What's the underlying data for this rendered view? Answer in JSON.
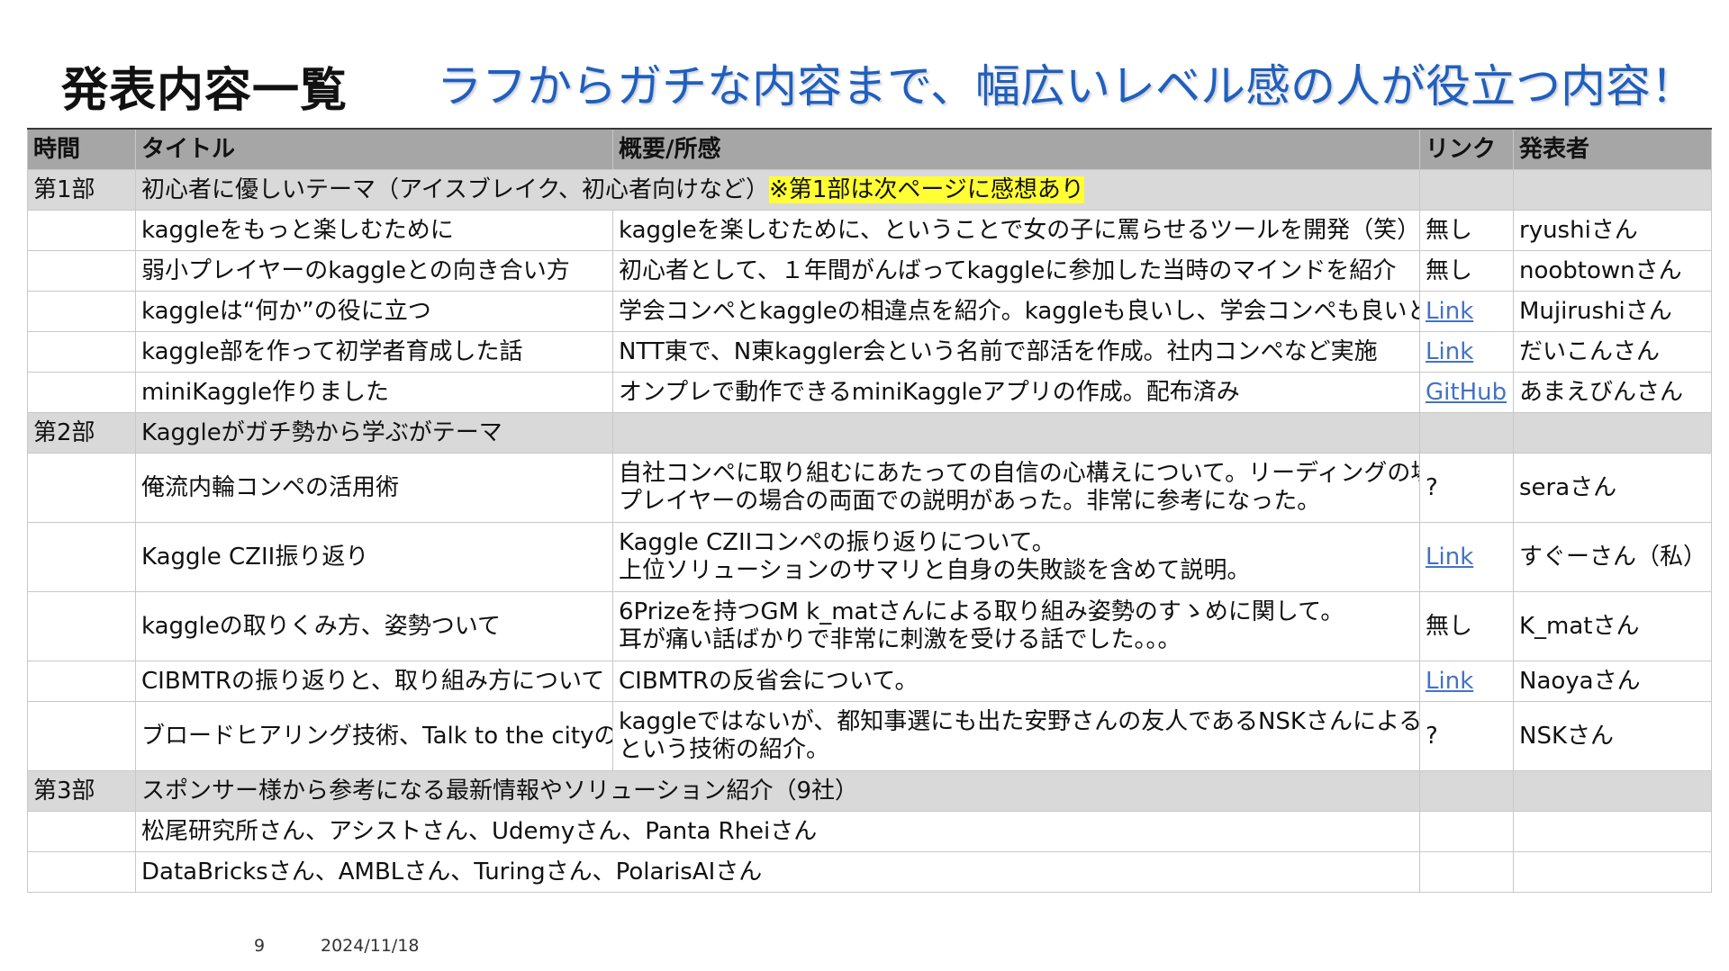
{
  "slide": {
    "title": "発表内容一覧",
    "subtitle": "ラフからガチな内容まで、幅広いレベル感の人が役立つ内容！",
    "page_number": "9",
    "date": "2024/11/18"
  },
  "table": {
    "headers": [
      "時間",
      "タイトル",
      "概要/所感",
      "リンク",
      "発表者"
    ],
    "sections": [
      {
        "label": "第1部",
        "theme": "初心者に優しいテーマ（アイスブレイク、初心者向けなど）",
        "note": "※第1部は次ページに感想あり",
        "rows": [
          {
            "title": "kaggleをもっと楽しむために",
            "summary": [
              "kaggleを楽しむために、ということで女の子に罵らせるツールを開発（笑）"
            ],
            "link": "無し",
            "presenter": "ryushiさん"
          },
          {
            "title": "弱小プレイヤーのkaggleとの向き合い方",
            "summary": [
              "初心者として、１年間がんばってkaggleに参加した当時のマインドを紹介"
            ],
            "link": "無し",
            "presenter": "noobtownさん"
          },
          {
            "title": "kaggleは“何か”の役に立つ",
            "summary": [
              "学会コンペとkaggleの相違点を紹介。kaggleも良いし、学会コンペも良いという。"
            ],
            "link": "Link",
            "presenter": "Mujirushiさん"
          },
          {
            "title": "kaggle部を作って初学者育成した話",
            "summary": [
              "NTT東で、N東kaggler会という名前で部活を作成。社内コンペなど実施"
            ],
            "link": "Link",
            "presenter": "だいこんさん"
          },
          {
            "title": "miniKaggle作りました",
            "summary": [
              "オンプレで動作できるminiKaggleアプリの作成。配布済み"
            ],
            "link": "GitHub",
            "presenter": "あまえびんさん"
          }
        ]
      },
      {
        "label": "第2部",
        "theme": "Kaggleがガチ勢から学ぶがテーマ",
        "rows": [
          {
            "title": "俺流内輪コンペの活用術",
            "summary": [
              "自社コンペに取り組むにあたっての自信の心構えについて。リーディングの場合と、",
              "プレイヤーの場合の両面での説明があった。非常に参考になった。"
            ],
            "link": "?",
            "presenter": "seraさん"
          },
          {
            "title": "Kaggle CZII振り返り",
            "summary": [
              "Kaggle CZIIコンペの振り返りについて。",
              "上位ソリューションのサマリと自身の失敗談を含めて説明。"
            ],
            "link": "Link",
            "presenter": "すぐーさん（私）"
          },
          {
            "title": "kaggleの取りくみ方、姿勢ついて",
            "summary": [
              "6Prizeを持つGM k_matさんによる取り組み姿勢のすゝめに関して。",
              "耳が痛い話ばかりで非常に刺激を受ける話でした。。。"
            ],
            "link": "無し",
            "presenter": "K_matさん"
          },
          {
            "title": "CIBMTRの振り返りと、取り組み方について",
            "summary": [
              "CIBMTRの反省会について。"
            ],
            "link": "Link",
            "presenter": "Naoyaさん"
          },
          {
            "title": "ブロードヒアリング技術、Talk to the cityの紹介",
            "summary": [
              "kaggleではないが、都知事選にも出た安野さんの友人であるNSKさんによるTttC",
              "という技術の紹介。"
            ],
            "link": "?",
            "presenter": "NSKさん"
          }
        ]
      },
      {
        "label": "第3部",
        "theme": "スポンサー様から参考になる最新情報やソリューション紹介（9社）",
        "sponsors": [
          "松尾研究所さん、アシストさん、Udemyさん、Panta Rheiさん",
          "DataBricksさん、AMBLさん、Turingさん、PolarisAIさん"
        ]
      }
    ]
  },
  "colors": {
    "header_bg": "#a6a6a6",
    "section_bg": "#d9d9d9",
    "highlight": "#ffff33",
    "subtitle": "#1f5fbf",
    "link": "#4472c4"
  }
}
